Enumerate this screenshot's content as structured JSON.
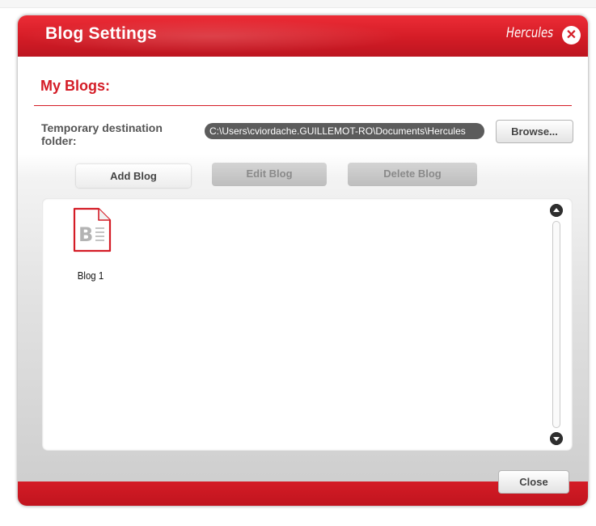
{
  "window": {
    "title": "Blog Settings",
    "brand": "Hercules",
    "close_glyph": "✕"
  },
  "my_blogs": {
    "heading": "My Blogs:"
  },
  "destination": {
    "label": "Temporary destination folder:",
    "path": "C:\\Users\\cviordache.GUILLEMOT-RO\\Documents\\Hercules",
    "browse_label": "Browse..."
  },
  "actions": {
    "add_label": "Add Blog",
    "edit_label": "Edit Blog",
    "delete_label": "Delete Blog"
  },
  "blogs": [
    {
      "label": "Blog 1",
      "icon": "blog-document-icon"
    }
  ],
  "footer": {
    "close_label": "Close"
  },
  "colors": {
    "accent": "#d41c26",
    "field_bg": "#5c5c5c"
  }
}
